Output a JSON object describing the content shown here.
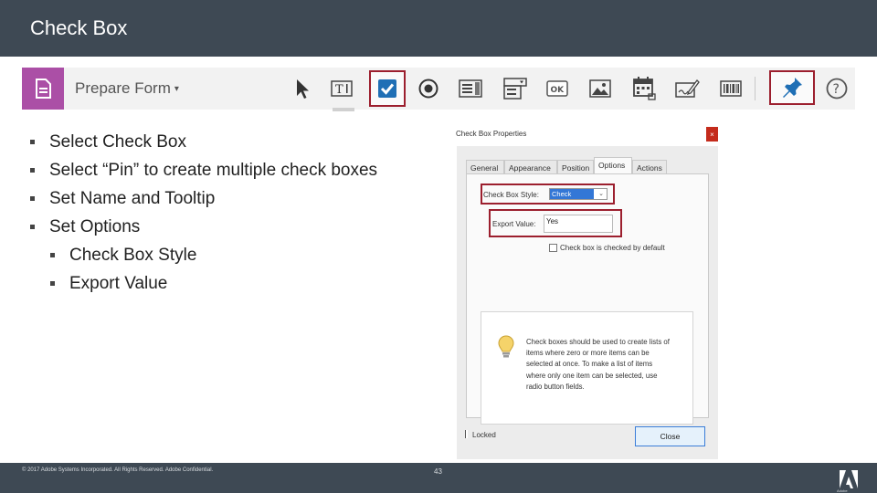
{
  "slide": {
    "title": "Check Box"
  },
  "toolbar": {
    "mode_label": "Prepare Form",
    "mode_caret": "▾",
    "tools": [
      {
        "icon": "select-arrow-icon",
        "selected": false
      },
      {
        "icon": "text-field-icon",
        "selected": false
      },
      {
        "icon": "check-box-icon",
        "selected": true
      },
      {
        "icon": "radio-button-icon",
        "selected": false
      },
      {
        "icon": "list-box-icon",
        "selected": false
      },
      {
        "icon": "dropdown-icon",
        "selected": false
      },
      {
        "icon": "button-icon",
        "selected": false,
        "text": "OK"
      },
      {
        "icon": "image-icon",
        "selected": false
      },
      {
        "icon": "date-field-icon",
        "selected": false
      },
      {
        "icon": "signature-icon",
        "selected": false
      },
      {
        "icon": "barcode-icon",
        "selected": false
      },
      {
        "icon": "pin-icon",
        "selected": true
      },
      {
        "icon": "help-icon",
        "selected": false
      }
    ],
    "accent_color": "#ab4fa6",
    "highlight_color": "#9c1f2e"
  },
  "bullets": [
    {
      "level": 1,
      "text": "Select Check Box"
    },
    {
      "level": 1,
      "text": "Select “Pin” to create multiple check boxes"
    },
    {
      "level": 1,
      "text": "Set Name and Tooltip"
    },
    {
      "level": 1,
      "text": "Set Options"
    },
    {
      "level": 2,
      "text": "Check Box Style"
    },
    {
      "level": 2,
      "text": "Export Value"
    }
  ],
  "dialog": {
    "title": "Check Box Properties",
    "close_label": "×",
    "tabs": [
      {
        "label": "General",
        "active": false
      },
      {
        "label": "Appearance",
        "active": false
      },
      {
        "label": "Position",
        "active": false
      },
      {
        "label": "Options",
        "active": true
      },
      {
        "label": "Actions",
        "active": false
      }
    ],
    "style_label": "Check Box Style:",
    "style_value": "Check",
    "style_caret": "⌄",
    "export_label": "Export Value:",
    "export_value": "Yes",
    "default_checked_label": "Check box is checked by default",
    "default_checked": false,
    "info_text": "Check boxes should be used to create lists of items where zero or more items can be selected at once. To make a list of items where only one item can be selected, use radio button fields.",
    "locked_label": "Locked",
    "locked": false,
    "close_button": "Close"
  },
  "footer": {
    "copyright": "© 2017 Adobe Systems Incorporated. All Rights Reserved. Adobe Confidential.",
    "page_number": "43",
    "logo_text": "Adobe"
  },
  "colors": {
    "header_bg": "#3e4954",
    "footer_bg": "#3e4954"
  }
}
